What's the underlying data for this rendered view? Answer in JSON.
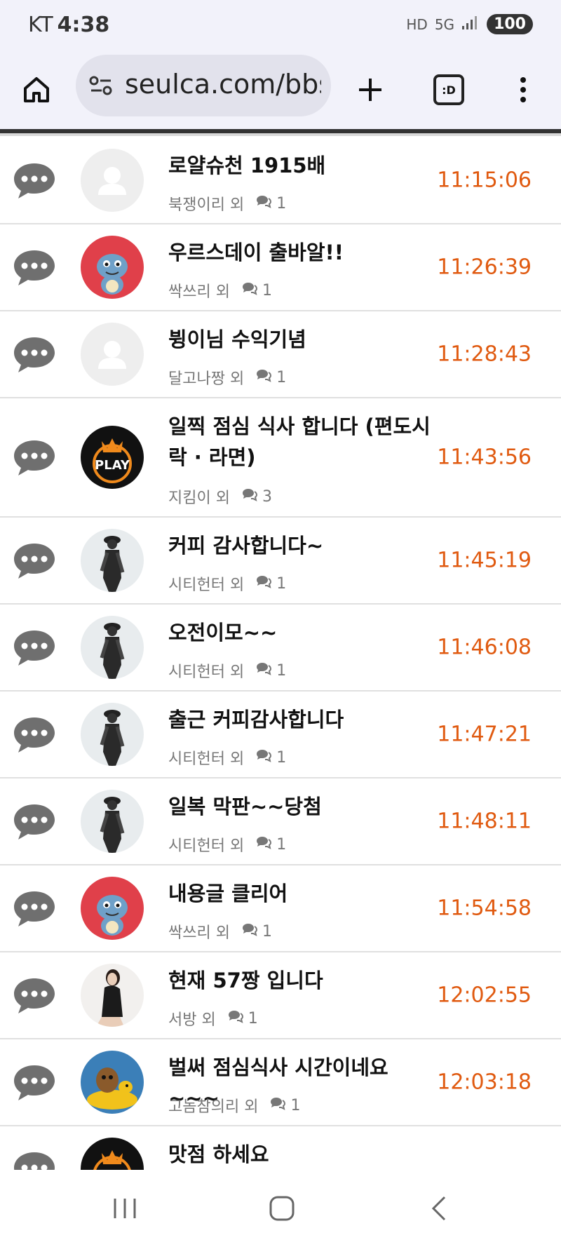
{
  "status": {
    "carrier": "KT",
    "time": "4:38",
    "battery": "100",
    "network": "5G",
    "hd": "HD"
  },
  "browser": {
    "url": "seulca.com/bbs",
    "tab_label": ":D"
  },
  "posts": [
    {
      "title": "로얄슈천 1915배",
      "author": "북쟁이리 외",
      "comments": "1",
      "time": "11:15:06",
      "avatar": "default"
    },
    {
      "title": "우르스데이 출바알!!",
      "author": "싹쓰리 외",
      "comments": "1",
      "time": "11:26:39",
      "avatar": "dragon"
    },
    {
      "title": "뷩이님 수익기념",
      "author": "달고나짱 외",
      "comments": "1",
      "time": "11:28:43",
      "avatar": "default"
    },
    {
      "title": "일찍 점심 식사 합니다 (편도시락 · 라면)",
      "author": "지킴이 외",
      "comments": "3",
      "time": "11:43:56",
      "avatar": "play"
    },
    {
      "title": "커피 감사합니다~",
      "author": "시티헌터 외",
      "comments": "1",
      "time": "11:45:19",
      "avatar": "figure"
    },
    {
      "title": "오전이모~~",
      "author": "시티헌터 외",
      "comments": "1",
      "time": "11:46:08",
      "avatar": "figure"
    },
    {
      "title": "출근 커피감사합니다",
      "author": "시티헌터 외",
      "comments": "1",
      "time": "11:47:21",
      "avatar": "figure"
    },
    {
      "title": "일복 막판~~당첨",
      "author": "시티헌터 외",
      "comments": "1",
      "time": "11:48:11",
      "avatar": "figure"
    },
    {
      "title": "내용글 클리어",
      "author": "싹쓰리 외",
      "comments": "1",
      "time": "11:54:58",
      "avatar": "dragon"
    },
    {
      "title": "현재 57짱 입니다",
      "author": "서방 외",
      "comments": "1",
      "time": "12:02:55",
      "avatar": "woman"
    },
    {
      "title": "벌써 점심식사 시간이네요~~~",
      "author": "고놈참의리 외",
      "comments": "1",
      "time": "12:03:18",
      "avatar": "otter"
    },
    {
      "title": "맛점 하세요",
      "author": "",
      "comments": "",
      "time": "",
      "avatar": "play"
    }
  ],
  "colors": {
    "time": "#e05a10",
    "chrome_bg": "#f2f2fa",
    "urlbar_bg": "#e2e2ec"
  }
}
